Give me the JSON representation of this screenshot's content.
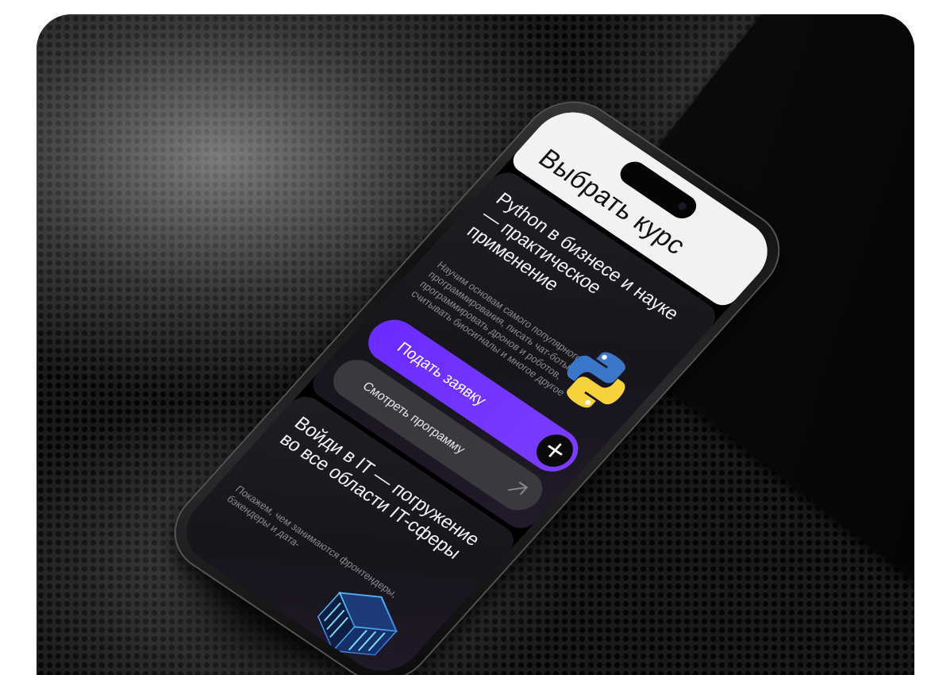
{
  "screen": {
    "title": "Выбрать курс"
  },
  "courses": [
    {
      "title": "Python в бизнесе и науке — практическое применение",
      "description": "Научим основам самого популярного языка программирования, писать чат-боты, программировать дронов и роботов, считывать биосигналы и многое другое",
      "icon": "python-logo-icon",
      "apply_label": "Подать заявку",
      "program_label": "Смотреть программу"
    },
    {
      "title": "Войди в IT — погружение во все области IT-сферы",
      "description": "Покажем, чем занимаются фронтендеры, бэкендеры и дата-",
      "icon": "chip-stack-icon"
    }
  ],
  "colors": {
    "accent": "#7230ff",
    "card_bg": "#1c1b20",
    "title_bg": "#f2f2f4",
    "secondary_btn": "#3a3a3e"
  }
}
